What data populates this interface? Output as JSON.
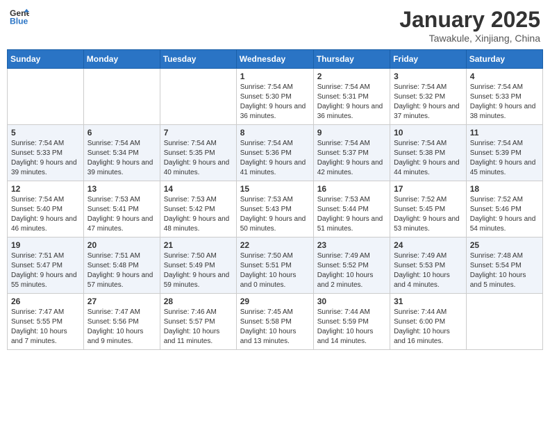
{
  "header": {
    "logo_line1": "General",
    "logo_line2": "Blue",
    "month_title": "January 2025",
    "location": "Tawakule, Xinjiang, China"
  },
  "weekdays": [
    "Sunday",
    "Monday",
    "Tuesday",
    "Wednesday",
    "Thursday",
    "Friday",
    "Saturday"
  ],
  "weeks": [
    [
      {
        "day": "",
        "sunrise": "",
        "sunset": "",
        "daylight": ""
      },
      {
        "day": "",
        "sunrise": "",
        "sunset": "",
        "daylight": ""
      },
      {
        "day": "",
        "sunrise": "",
        "sunset": "",
        "daylight": ""
      },
      {
        "day": "1",
        "sunrise": "Sunrise: 7:54 AM",
        "sunset": "Sunset: 5:30 PM",
        "daylight": "Daylight: 9 hours and 36 minutes."
      },
      {
        "day": "2",
        "sunrise": "Sunrise: 7:54 AM",
        "sunset": "Sunset: 5:31 PM",
        "daylight": "Daylight: 9 hours and 36 minutes."
      },
      {
        "day": "3",
        "sunrise": "Sunrise: 7:54 AM",
        "sunset": "Sunset: 5:32 PM",
        "daylight": "Daylight: 9 hours and 37 minutes."
      },
      {
        "day": "4",
        "sunrise": "Sunrise: 7:54 AM",
        "sunset": "Sunset: 5:33 PM",
        "daylight": "Daylight: 9 hours and 38 minutes."
      }
    ],
    [
      {
        "day": "5",
        "sunrise": "Sunrise: 7:54 AM",
        "sunset": "Sunset: 5:33 PM",
        "daylight": "Daylight: 9 hours and 39 minutes."
      },
      {
        "day": "6",
        "sunrise": "Sunrise: 7:54 AM",
        "sunset": "Sunset: 5:34 PM",
        "daylight": "Daylight: 9 hours and 39 minutes."
      },
      {
        "day": "7",
        "sunrise": "Sunrise: 7:54 AM",
        "sunset": "Sunset: 5:35 PM",
        "daylight": "Daylight: 9 hours and 40 minutes."
      },
      {
        "day": "8",
        "sunrise": "Sunrise: 7:54 AM",
        "sunset": "Sunset: 5:36 PM",
        "daylight": "Daylight: 9 hours and 41 minutes."
      },
      {
        "day": "9",
        "sunrise": "Sunrise: 7:54 AM",
        "sunset": "Sunset: 5:37 PM",
        "daylight": "Daylight: 9 hours and 42 minutes."
      },
      {
        "day": "10",
        "sunrise": "Sunrise: 7:54 AM",
        "sunset": "Sunset: 5:38 PM",
        "daylight": "Daylight: 9 hours and 44 minutes."
      },
      {
        "day": "11",
        "sunrise": "Sunrise: 7:54 AM",
        "sunset": "Sunset: 5:39 PM",
        "daylight": "Daylight: 9 hours and 45 minutes."
      }
    ],
    [
      {
        "day": "12",
        "sunrise": "Sunrise: 7:54 AM",
        "sunset": "Sunset: 5:40 PM",
        "daylight": "Daylight: 9 hours and 46 minutes."
      },
      {
        "day": "13",
        "sunrise": "Sunrise: 7:53 AM",
        "sunset": "Sunset: 5:41 PM",
        "daylight": "Daylight: 9 hours and 47 minutes."
      },
      {
        "day": "14",
        "sunrise": "Sunrise: 7:53 AM",
        "sunset": "Sunset: 5:42 PM",
        "daylight": "Daylight: 9 hours and 48 minutes."
      },
      {
        "day": "15",
        "sunrise": "Sunrise: 7:53 AM",
        "sunset": "Sunset: 5:43 PM",
        "daylight": "Daylight: 9 hours and 50 minutes."
      },
      {
        "day": "16",
        "sunrise": "Sunrise: 7:53 AM",
        "sunset": "Sunset: 5:44 PM",
        "daylight": "Daylight: 9 hours and 51 minutes."
      },
      {
        "day": "17",
        "sunrise": "Sunrise: 7:52 AM",
        "sunset": "Sunset: 5:45 PM",
        "daylight": "Daylight: 9 hours and 53 minutes."
      },
      {
        "day": "18",
        "sunrise": "Sunrise: 7:52 AM",
        "sunset": "Sunset: 5:46 PM",
        "daylight": "Daylight: 9 hours and 54 minutes."
      }
    ],
    [
      {
        "day": "19",
        "sunrise": "Sunrise: 7:51 AM",
        "sunset": "Sunset: 5:47 PM",
        "daylight": "Daylight: 9 hours and 55 minutes."
      },
      {
        "day": "20",
        "sunrise": "Sunrise: 7:51 AM",
        "sunset": "Sunset: 5:48 PM",
        "daylight": "Daylight: 9 hours and 57 minutes."
      },
      {
        "day": "21",
        "sunrise": "Sunrise: 7:50 AM",
        "sunset": "Sunset: 5:49 PM",
        "daylight": "Daylight: 9 hours and 59 minutes."
      },
      {
        "day": "22",
        "sunrise": "Sunrise: 7:50 AM",
        "sunset": "Sunset: 5:51 PM",
        "daylight": "Daylight: 10 hours and 0 minutes."
      },
      {
        "day": "23",
        "sunrise": "Sunrise: 7:49 AM",
        "sunset": "Sunset: 5:52 PM",
        "daylight": "Daylight: 10 hours and 2 minutes."
      },
      {
        "day": "24",
        "sunrise": "Sunrise: 7:49 AM",
        "sunset": "Sunset: 5:53 PM",
        "daylight": "Daylight: 10 hours and 4 minutes."
      },
      {
        "day": "25",
        "sunrise": "Sunrise: 7:48 AM",
        "sunset": "Sunset: 5:54 PM",
        "daylight": "Daylight: 10 hours and 5 minutes."
      }
    ],
    [
      {
        "day": "26",
        "sunrise": "Sunrise: 7:47 AM",
        "sunset": "Sunset: 5:55 PM",
        "daylight": "Daylight: 10 hours and 7 minutes."
      },
      {
        "day": "27",
        "sunrise": "Sunrise: 7:47 AM",
        "sunset": "Sunset: 5:56 PM",
        "daylight": "Daylight: 10 hours and 9 minutes."
      },
      {
        "day": "28",
        "sunrise": "Sunrise: 7:46 AM",
        "sunset": "Sunset: 5:57 PM",
        "daylight": "Daylight: 10 hours and 11 minutes."
      },
      {
        "day": "29",
        "sunrise": "Sunrise: 7:45 AM",
        "sunset": "Sunset: 5:58 PM",
        "daylight": "Daylight: 10 hours and 13 minutes."
      },
      {
        "day": "30",
        "sunrise": "Sunrise: 7:44 AM",
        "sunset": "Sunset: 5:59 PM",
        "daylight": "Daylight: 10 hours and 14 minutes."
      },
      {
        "day": "31",
        "sunrise": "Sunrise: 7:44 AM",
        "sunset": "Sunset: 6:00 PM",
        "daylight": "Daylight: 10 hours and 16 minutes."
      },
      {
        "day": "",
        "sunrise": "",
        "sunset": "",
        "daylight": ""
      }
    ]
  ]
}
